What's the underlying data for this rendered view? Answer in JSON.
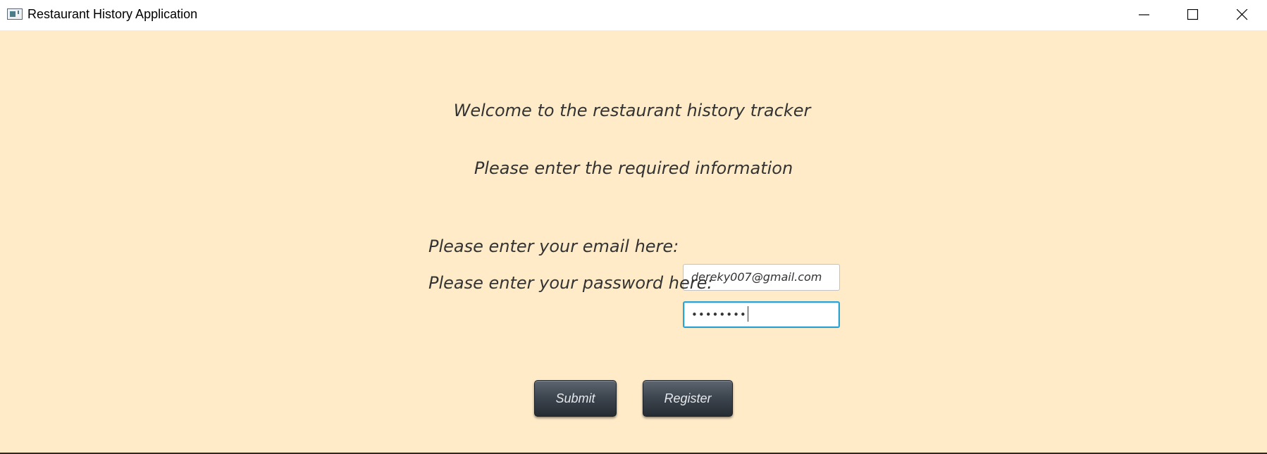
{
  "window": {
    "title": "Restaurant History Application",
    "controls": [
      "minimize-icon",
      "maximize-icon",
      "close-icon"
    ]
  },
  "form": {
    "welcome": "Welcome to the restaurant history tracker",
    "instructions": "Please enter the required information",
    "email_label": "Please enter your email here:",
    "email_value": "dereky007@gmail.com",
    "password_label": "Please enter your password here:",
    "password_value": "••••••••",
    "submit_label": "Submit",
    "register_label": "Register"
  },
  "colors": {
    "background": "#ffebc8",
    "focus_border": "#2aa3d6",
    "button_top": "#5d6670",
    "button_bottom": "#262c33"
  }
}
